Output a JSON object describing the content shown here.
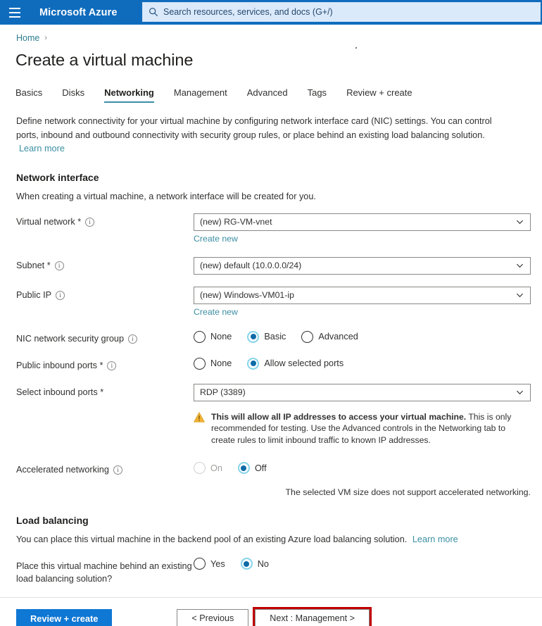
{
  "topbar": {
    "menu_icon": "hamburger-icon",
    "brand": "Microsoft Azure",
    "search_icon": "search-icon",
    "search_placeholder": "Search resources, services, and docs (G+/)"
  },
  "breadcrumb": {
    "home": "Home",
    "chevron": "›"
  },
  "page_title": "Create a virtual machine",
  "tabs": [
    {
      "label": "Basics",
      "active": false
    },
    {
      "label": "Disks",
      "active": false
    },
    {
      "label": "Networking",
      "active": true
    },
    {
      "label": "Management",
      "active": false
    },
    {
      "label": "Advanced",
      "active": false
    },
    {
      "label": "Tags",
      "active": false
    },
    {
      "label": "Review + create",
      "active": false
    }
  ],
  "intro": {
    "paragraph": "Define network connectivity for your virtual machine by configuring network interface card (NIC) settings. You can control ports, inbound and outbound connectivity with security group rules, or place behind an existing load balancing solution.",
    "learn_more": "Learn more"
  },
  "network_interface": {
    "heading": "Network interface",
    "subtext": "When creating a virtual machine, a network interface will be created for you.",
    "virtual_network": {
      "label": "Virtual network",
      "required": "*",
      "info_icon": "info-icon",
      "value": "(new) RG-VM-vnet",
      "create_new": "Create new"
    },
    "subnet": {
      "label": "Subnet",
      "required": "*",
      "info_icon": "info-icon",
      "value": "(new) default (10.0.0.0/24)"
    },
    "public_ip": {
      "label": "Public IP",
      "required": "",
      "info_icon": "info-icon",
      "value": "(new) Windows-VM01-ip",
      "create_new": "Create new"
    },
    "nic_nsg": {
      "label": "NIC network security group",
      "required": "",
      "info_icon": "info-icon",
      "options": [
        {
          "label": "None",
          "checked": false
        },
        {
          "label": "Basic",
          "checked": true
        },
        {
          "label": "Advanced",
          "checked": false
        }
      ]
    },
    "public_inbound_ports": {
      "label": "Public inbound ports",
      "required": "*",
      "info_icon": "info-icon",
      "options": [
        {
          "label": "None",
          "checked": false
        },
        {
          "label": "Allow selected ports",
          "checked": true
        }
      ]
    },
    "select_inbound_ports": {
      "label": "Select inbound ports",
      "required": "*",
      "value": "RDP (3389)"
    },
    "warning": {
      "icon": "warning-triangle-icon",
      "bold_text": "This will allow all IP addresses to access your virtual machine.",
      "rest_text": "This is only recommended for testing.  Use the Advanced controls in the Networking tab to create rules to limit inbound traffic to known IP addresses."
    },
    "accelerated_networking": {
      "label": "Accelerated networking",
      "required": "",
      "info_icon": "info-icon",
      "options": [
        {
          "label": "On",
          "checked": false,
          "disabled": true
        },
        {
          "label": "Off",
          "checked": true,
          "disabled": false
        }
      ],
      "hint": "The selected VM size does not support accelerated networking."
    }
  },
  "load_balancing": {
    "heading": "Load balancing",
    "subtext": "You can place this virtual machine in the backend pool of an existing Azure load balancing solution.",
    "learn_more": "Learn more",
    "place_behind": {
      "label": "Place this virtual machine behind an existing load balancing solution?",
      "options": [
        {
          "label": "Yes",
          "checked": false
        },
        {
          "label": "No",
          "checked": true
        }
      ]
    }
  },
  "footer": {
    "review_create": "Review + create",
    "previous": "< Previous",
    "next": "Next : Management >",
    "highlight_color": "#c00000"
  }
}
